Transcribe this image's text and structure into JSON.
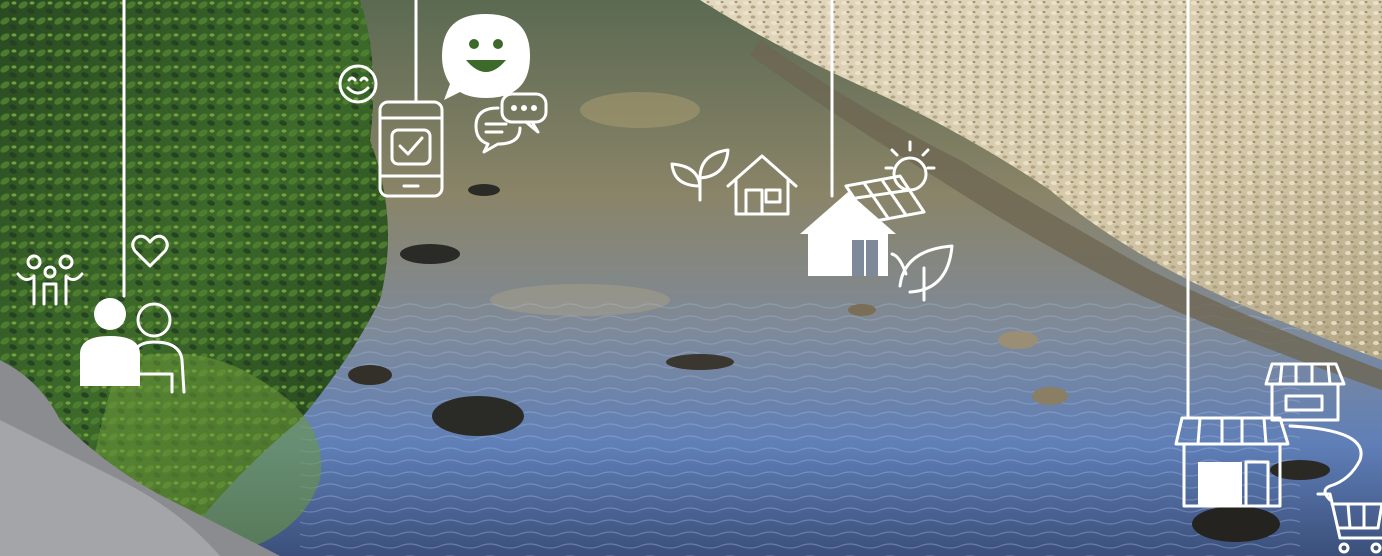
{
  "scene": {
    "description_free": true,
    "palette": {
      "foliage_dark": "#1f3a1a",
      "foliage_mid": "#3d6a2a",
      "foliage_light": "#6e9a3a",
      "water_top": "#5b6a52",
      "water_mid": "#7e8a8a",
      "water_blue": "#5f7fb8",
      "water_deep": "#3b4f7a",
      "gravel_light": "#e3d8bf",
      "gravel_mid": "#cbbf9f",
      "gravel_dark": "#8c7f62",
      "rock_dark": "#2a2a26",
      "rock_grey": "#8a8c90",
      "icon_color": "#ffffff"
    },
    "icons": [
      "family-icon",
      "heart-icon",
      "two-people-icon",
      "smiley-face-icon",
      "speech-smiley-icon",
      "smartphone-check-icon",
      "chat-bubbles-icon",
      "leaf-sprout-icon",
      "house-outline-icon",
      "sun-icon",
      "solar-panel-icon",
      "house-filled-icon",
      "leaf-icon",
      "market-stall-icon",
      "storefront-icon",
      "shopping-cart-icon"
    ]
  }
}
